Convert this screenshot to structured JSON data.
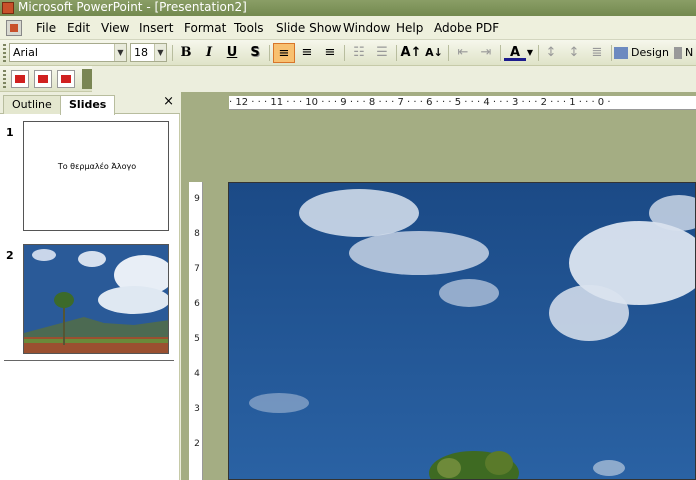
{
  "window": {
    "title": "Microsoft PowerPoint - [Presentation2]"
  },
  "menu": {
    "items": [
      "File",
      "Edit",
      "View",
      "Insert",
      "Format",
      "Tools",
      "Slide Show",
      "Window",
      "Help",
      "Adobe PDF"
    ]
  },
  "formatting": {
    "font": "Arial",
    "size": "18",
    "bold": "B",
    "italic": "I",
    "underline": "U",
    "shadow": "S",
    "design_label": "Design",
    "new_slide_partial": "N"
  },
  "panel": {
    "tabs": [
      "Outline",
      "Slides"
    ],
    "active_tab": "Slides",
    "close": "×",
    "slides": [
      {
        "number": "1",
        "text": "Το θερμαλέο Άλογο"
      },
      {
        "number": "2",
        "text": ""
      }
    ]
  },
  "ruler": {
    "horizontal": "· 12 · · · 11 · · · 10 · · · 9 · · · 8 · · · 7 · · · 6 · · · 5 · · · 4 · · · 3 · · · 2 · · · 1 · · · 0 ·",
    "vertical": [
      "9",
      "8",
      "7",
      "6",
      "5",
      "4",
      "3",
      "2"
    ]
  },
  "colors": {
    "title_bar": "#7a9058",
    "accent": "#f8c070",
    "sky": "#1d4f8a"
  }
}
